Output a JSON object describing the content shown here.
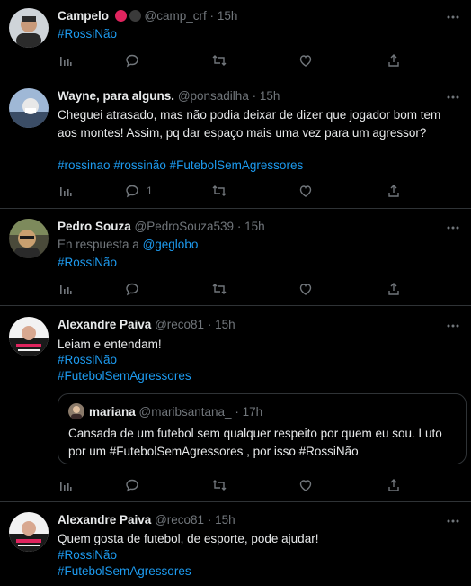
{
  "tweets": [
    {
      "name": "Campelo",
      "handle": "@camp_crf",
      "time": "15h",
      "badges": [
        "#e0245e",
        "#3a3a3a"
      ],
      "lines": [
        [
          "#RossiNão"
        ]
      ],
      "reply_count": "",
      "avatar_colors": [
        "#cfd4d9",
        "#2b2b2b"
      ]
    },
    {
      "name": "Wayne, para alguns.",
      "handle": "@ponsadilha",
      "time": "15h",
      "text": "Cheguei atrasado, mas não podia deixar de dizer que jogador bom tem aos montes! Assim, pq dar espaço mais uma vez para um agressor?",
      "hashtags": [
        "#rossinao",
        "#rossinão",
        "#FutebolSemAgressores"
      ],
      "reply_count": "1",
      "avatar_colors": [
        "#9fb8d6",
        "#e8e8e8"
      ]
    },
    {
      "name": "Pedro Souza",
      "handle": "@PedroSouza539",
      "time": "15h",
      "reply_to_label": "En respuesta a",
      "reply_to": "@geglobo",
      "hashtag": "#RossiNão",
      "reply_count": "",
      "avatar_colors": [
        "#4a4a3a",
        "#c9a070"
      ]
    },
    {
      "name": "Alexandre Paiva",
      "handle": "@reco81",
      "time": "15h",
      "text": "Leiam e entendam!",
      "hashtags": [
        "#RossiNão",
        "#FutebolSemAgressores"
      ],
      "quote": {
        "name": "mariana",
        "handle": "@maribsantana_",
        "time": "17h",
        "text_1": "Cansada de um futebol sem qualquer respeito por quem eu sou. Luto por um ",
        "hashtag_1": "#FutebolSemAgressores",
        "text_2": " , por isso ",
        "hashtag_2": "#RossiNão"
      },
      "reply_count": "",
      "avatar_colors": [
        "#f2f2f2",
        "#1a1a1a"
      ]
    },
    {
      "name": "Alexandre Paiva",
      "handle": "@reco81",
      "time": "15h",
      "text": "Quem gosta de futebol, de esporte, pode ajudar!",
      "hashtags": [
        "#RossiNão",
        "#FutebolSemAgressores"
      ],
      "avatar_colors": [
        "#f2f2f2",
        "#1a1a1a"
      ]
    }
  ],
  "separator": "·",
  "colors": {
    "background": "#000000",
    "text": "#e7e9ea",
    "muted": "#71767b",
    "link": "#1d9bf0",
    "border": "#2f3336"
  },
  "icons": [
    "views-icon",
    "reply-icon",
    "retweet-icon",
    "like-icon",
    "share-icon",
    "more-icon"
  ]
}
